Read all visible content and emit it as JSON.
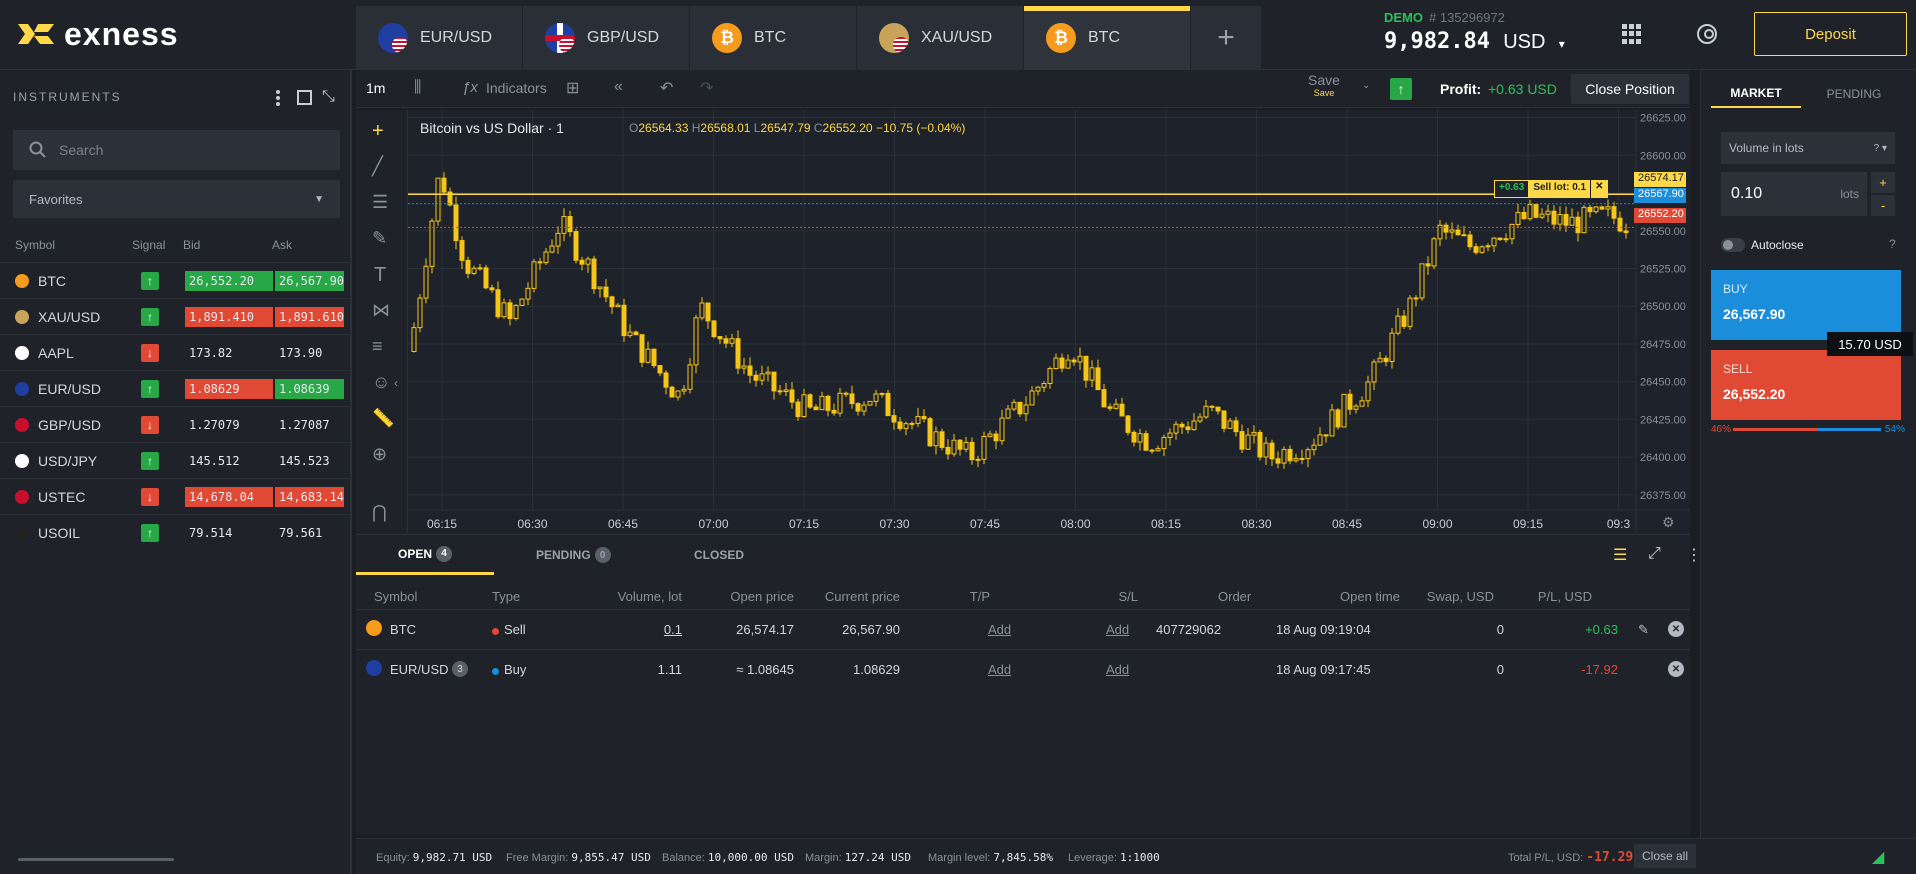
{
  "app": {
    "logo": "exness"
  },
  "tabs": [
    {
      "label": "EUR/USD",
      "icon": "flag-eu-us"
    },
    {
      "label": "GBP/USD",
      "icon": "flag-gb-us"
    },
    {
      "label": "BTC",
      "icon": "bitcoin-icon"
    },
    {
      "label": "XAU/USD",
      "icon": "gold-us-icon"
    },
    {
      "label": "BTC",
      "icon": "bitcoin-icon"
    }
  ],
  "account": {
    "type": "DEMO",
    "number": "# 135296972",
    "balance": "9,982.84",
    "currency": "USD"
  },
  "deposit_label": "Deposit",
  "instruments": {
    "title": "INSTRUMENTS",
    "search_placeholder": "Search",
    "favorites": "Favorites",
    "headers": {
      "symbol": "Symbol",
      "signal": "Signal",
      "bid": "Bid",
      "ask": "Ask"
    },
    "rows": [
      {
        "symbol": "BTC",
        "signal": "up",
        "bid": "26,552.20",
        "ask": "26,567.90",
        "hl": "up"
      },
      {
        "symbol": "XAU/USD",
        "signal": "up",
        "bid": "1,891.410",
        "ask": "1,891.610",
        "hl": "dn"
      },
      {
        "symbol": "AAPL",
        "signal": "dn",
        "bid": "173.82",
        "ask": "173.90",
        "hl": "none"
      },
      {
        "symbol": "EUR/USD",
        "signal": "up",
        "bid": "1.08629",
        "ask": "1.08639",
        "hl": "mix"
      },
      {
        "symbol": "GBP/USD",
        "signal": "dn",
        "bid": "1.27079",
        "ask": "1.27087",
        "hl": "none"
      },
      {
        "symbol": "USD/JPY",
        "signal": "up",
        "bid": "145.512",
        "ask": "145.523",
        "hl": "none"
      },
      {
        "symbol": "USTEC",
        "signal": "dn",
        "bid": "14,678.04",
        "ask": "14,683.14",
        "hl": "dn"
      },
      {
        "symbol": "USOIL",
        "signal": "up",
        "bid": "79.514",
        "ask": "79.561",
        "hl": "none"
      }
    ]
  },
  "toolbar": {
    "timeframe": "1m",
    "indicators": "Indicators",
    "save": "Save",
    "save_sub": "Save",
    "profit_label": "Profit:",
    "profit_value": "+0.63 USD",
    "close_position": "Close Position"
  },
  "chart": {
    "title": "Bitcoin vs US Dollar · 1",
    "ohlc": {
      "o": "26564.33",
      "h": "26568.01",
      "l": "26547.79",
      "c": "26552.20",
      "chg": "−10.75 (−0.04%)"
    },
    "y_ticks": [
      "26625.00",
      "26600.00",
      "26575.00",
      "26550.00",
      "26525.00",
      "26500.00",
      "26475.00",
      "26450.00",
      "26425.00",
      "26400.00",
      "26375.00"
    ],
    "x_ticks": [
      "06:15",
      "06:30",
      "06:45",
      "07:00",
      "07:15",
      "07:30",
      "07:45",
      "08:00",
      "08:15",
      "08:30",
      "08:45",
      "09:00",
      "09:15",
      "09:3"
    ],
    "labels": {
      "sell_line": "26574.17",
      "ask": "26567.90",
      "bid": "26552.20",
      "pl_badge": "+0.63",
      "sell_lot": "Sell lot: 0.1"
    }
  },
  "orders": {
    "tabs": {
      "open": "OPEN",
      "open_count": "4",
      "pending": "PENDING",
      "pending_count": "0",
      "closed": "CLOSED"
    },
    "headers": [
      "Symbol",
      "Type",
      "Volume, lot",
      "Open price",
      "Current price",
      "T/P",
      "S/L",
      "Order",
      "Open time",
      "Swap, USD",
      "P/L, USD"
    ],
    "rows": [
      {
        "symbol": "BTC",
        "badge": "",
        "type": "Sell",
        "volume": "0.1",
        "open": "26,574.17",
        "current": "26,567.90",
        "tp": "Add",
        "sl": "Add",
        "order": "407729062",
        "time": "18 Aug 09:19:04",
        "swap": "0",
        "pl": "+0.63"
      },
      {
        "symbol": "EUR/USD",
        "badge": "3",
        "type": "Buy",
        "volume": "1.11",
        "open": "≈ 1.08645",
        "current": "1.08629",
        "tp": "Add",
        "sl": "Add",
        "order": "",
        "time": "18 Aug 09:17:45",
        "swap": "0",
        "pl": "-17.92"
      }
    ]
  },
  "footer": {
    "equity": "9,982.71 USD",
    "free_margin": "9,855.47 USD",
    "balance": "10,000.00 USD",
    "margin": "127.24 USD",
    "margin_level": "7,845.58%",
    "leverage": "1:1000",
    "total_pl": "-17.29",
    "close_all": "Close all",
    "labels": {
      "equity": "Equity:",
      "free_margin": "Free Margin:",
      "balance": "Balance:",
      "margin": "Margin:",
      "margin_level": "Margin level:",
      "leverage": "Leverage:",
      "total_pl": "Total P/L, USD:"
    }
  },
  "order_panel": {
    "tab_market": "MARKET",
    "tab_pending": "PENDING",
    "volume_label": "Volume in lots",
    "volume": "0.10",
    "unit": "lots",
    "autoclose": "Autoclose",
    "buy_label": "BUY",
    "buy_price": "26,567.90",
    "sell_label": "SELL",
    "sell_price": "26,552.20",
    "spread": "15.70 USD",
    "sell_pct": "46%",
    "buy_pct": "54%"
  },
  "colors": {
    "accent": "#ffd84a",
    "buy": "#1a8ddb",
    "sell": "#e04a35",
    "up": "#27a745",
    "candle": "#f5c518"
  }
}
